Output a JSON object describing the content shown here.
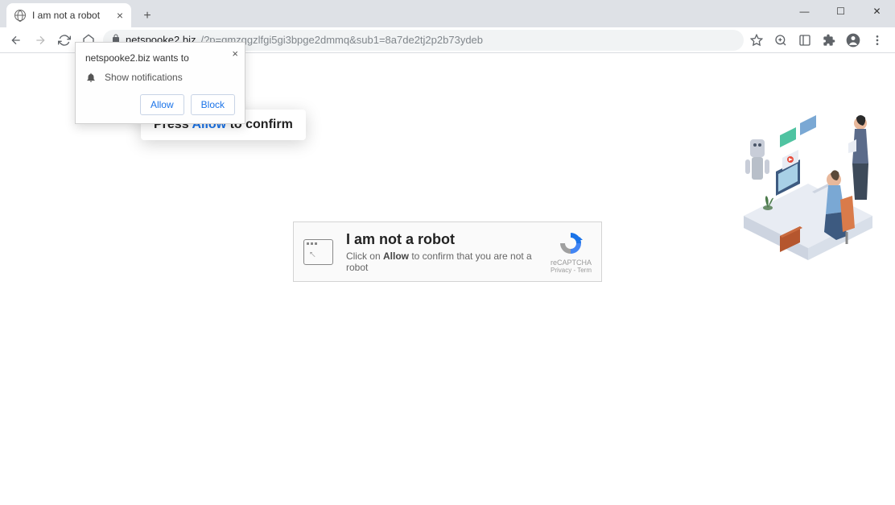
{
  "window": {
    "minimize": "—",
    "maximize": "☐",
    "close": "✕"
  },
  "tab": {
    "title": "I am not a robot",
    "close": "×",
    "new_tab": "+"
  },
  "nav": {
    "back": "←",
    "forward": "→",
    "reload": "⟳",
    "home": "⌂"
  },
  "url": {
    "domain": "netspooke2.biz",
    "path": "/?p=gmzggzlfgi5gi3bpge2dmmq&sub1=8a7de2tj2p2b73ydeb"
  },
  "toolbar_icons": {
    "star": "☆",
    "zoom": "⊕",
    "translate": "⊡",
    "extensions": "✱",
    "profile": "◯",
    "menu": "⋮"
  },
  "permission": {
    "title": "netspooke2.biz wants to",
    "show_notifications": "Show notifications",
    "allow": "Allow",
    "block": "Block",
    "close": "×"
  },
  "press_bubble": {
    "pre": "Press ",
    "highlight": "Allow",
    "post": " to confirm"
  },
  "captcha": {
    "heading": "I am not a robot",
    "line_pre": "Click on ",
    "line_bold": "Allow",
    "line_post": " to confirm that you are not a robot",
    "badge": "reCAPTCHA",
    "privacy": "Privacy",
    "sep": " - ",
    "terms": "Term"
  }
}
